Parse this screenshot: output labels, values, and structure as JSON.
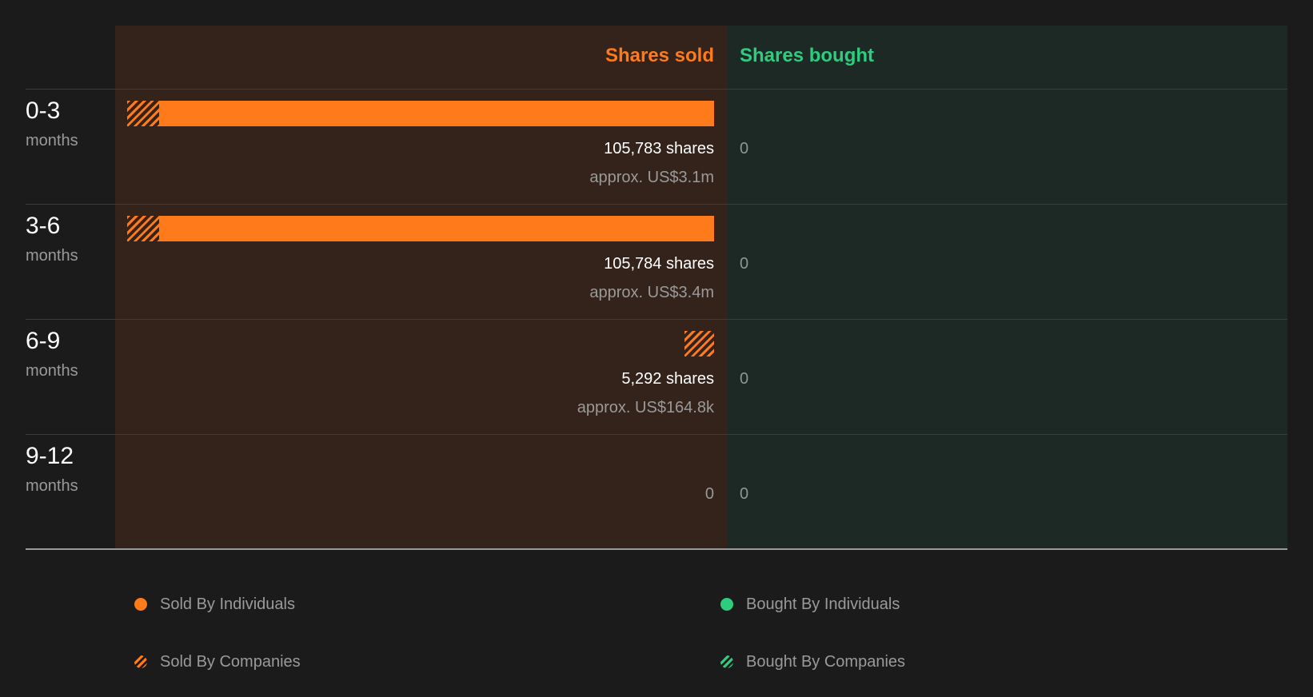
{
  "chart_data": {
    "type": "bar",
    "orientation": "horizontal",
    "headers": {
      "sold": "Shares sold",
      "bought": "Shares bought"
    },
    "categories": [
      {
        "period": "0-3",
        "unit": "months"
      },
      {
        "period": "3-6",
        "unit": "months"
      },
      {
        "period": "6-9",
        "unit": "months"
      },
      {
        "period": "9-12",
        "unit": "months"
      }
    ],
    "series": [
      {
        "name": "Sold By Individuals",
        "color": "#ff7a1a",
        "values": [
          100000,
          100000,
          0,
          0
        ]
      },
      {
        "name": "Sold By Companies",
        "color": "#ff7a1a",
        "pattern": "hatched",
        "values": [
          5783,
          5784,
          5292,
          0
        ]
      },
      {
        "name": "Bought By Individuals",
        "color": "#2ecc7f",
        "values": [
          0,
          0,
          0,
          0
        ]
      },
      {
        "name": "Bought By Companies",
        "color": "#2ecc7f",
        "pattern": "hatched",
        "values": [
          0,
          0,
          0,
          0
        ]
      }
    ],
    "sold_labels": [
      "105,783 shares",
      "105,784 shares",
      "5,292 shares",
      "0"
    ],
    "sold_approx": [
      "approx. US$3.1m",
      "approx. US$3.4m",
      "approx. US$164.8k",
      ""
    ],
    "bought_labels": [
      "0",
      "0",
      "0",
      "0"
    ],
    "xlim": [
      0,
      105784
    ]
  },
  "legend": [
    {
      "label": "Sold By Individuals",
      "color": "#ff7a1a",
      "style": "solid"
    },
    {
      "label": "Bought By Individuals",
      "color": "#2ecc7f",
      "style": "solid"
    },
    {
      "label": "Sold By Companies",
      "color": "#ff7a1a",
      "style": "hatched"
    },
    {
      "label": "Bought By Companies",
      "color": "#2ecc7f",
      "style": "hatched"
    }
  ]
}
